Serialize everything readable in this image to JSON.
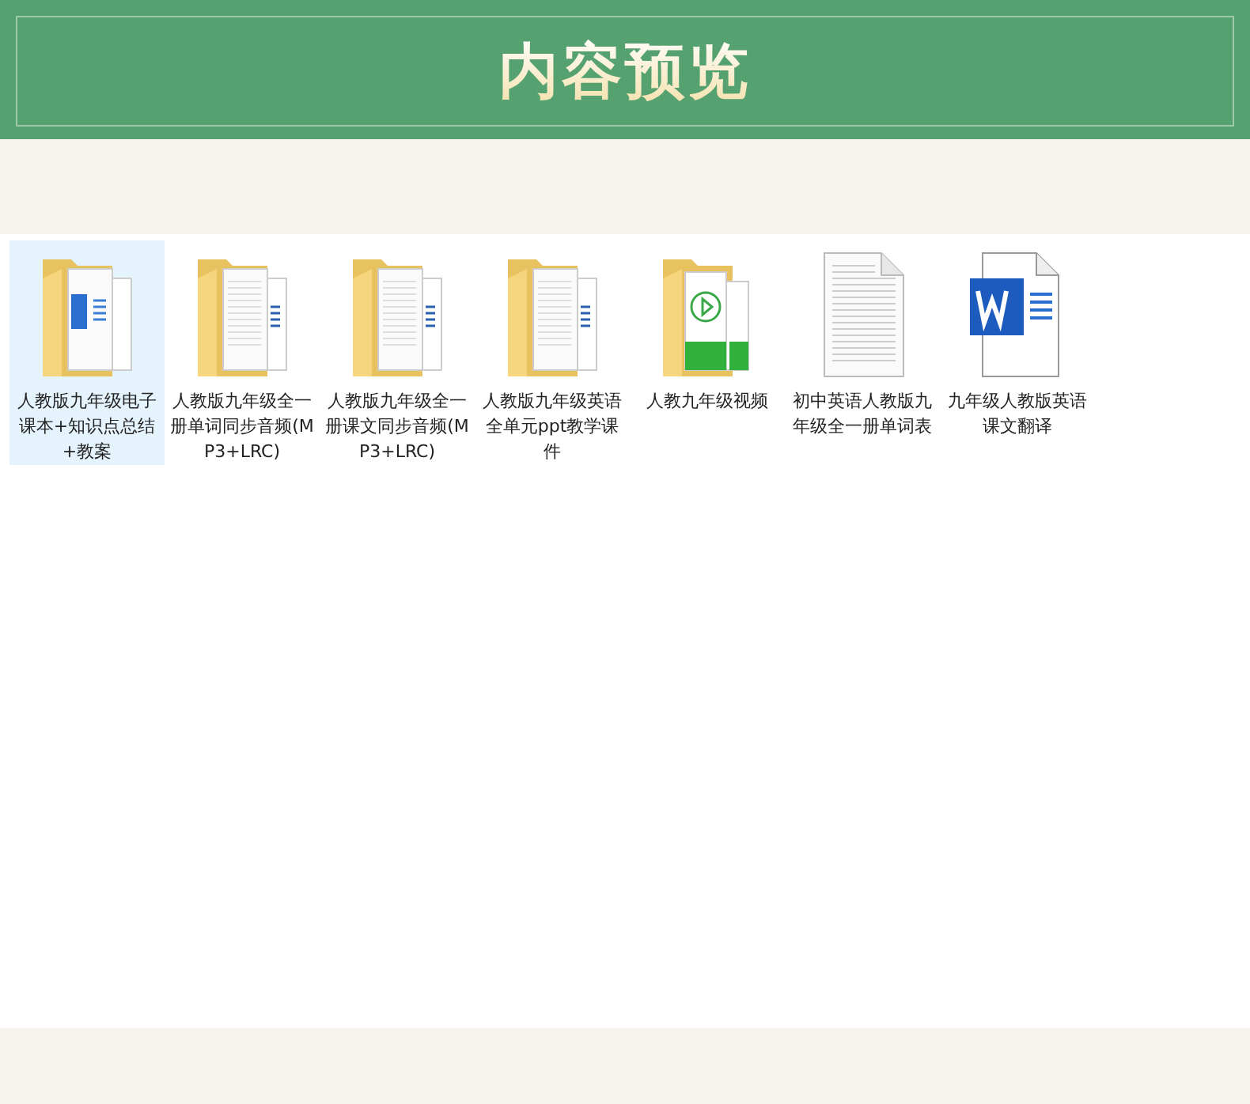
{
  "header": {
    "title": "内容预览"
  },
  "files": [
    {
      "name": "人教版九年级电子课本+知识点总结+教案",
      "kind": "folder-word",
      "selected": true
    },
    {
      "name": "人教版九年级全一册单词同步音频(MP3+LRC)",
      "kind": "folder-doc",
      "selected": false
    },
    {
      "name": "人教版九年级全一册课文同步音频(MP3+LRC)",
      "kind": "folder-doc",
      "selected": false
    },
    {
      "name": "人教版九年级英语全单元ppt教学课件",
      "kind": "folder-doc",
      "selected": false
    },
    {
      "name": "人教九年级视频",
      "kind": "folder-video",
      "selected": false
    },
    {
      "name": "初中英语人教版九年级全一册单词表",
      "kind": "text-file",
      "selected": false
    },
    {
      "name": "九年级人教版英语课文翻译",
      "kind": "word-file",
      "selected": false
    }
  ]
}
